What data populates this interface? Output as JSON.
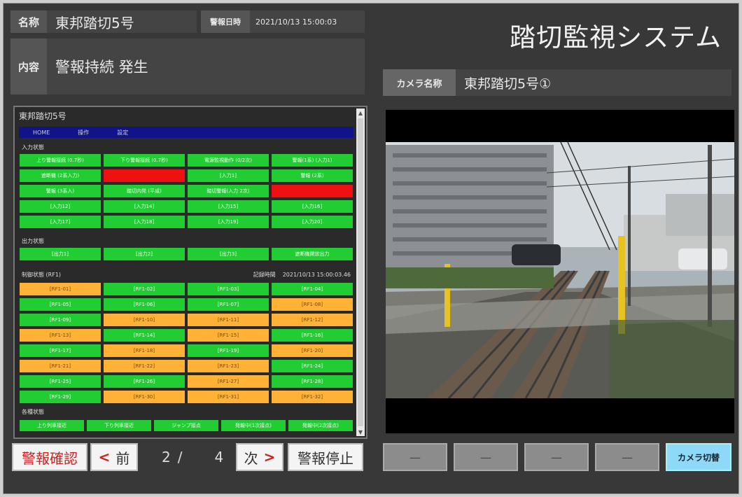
{
  "header": {
    "name_label": "名称",
    "name_value": "東邦踏切5号",
    "date_label": "警報日時",
    "date_value": "2021/10/13 15:00:03",
    "content_label": "内容",
    "content_value": "警報持続 発生"
  },
  "app_title": "踏切監視システム",
  "camera": {
    "name_label": "カメラ名称",
    "name_value": "東邦踏切5号①"
  },
  "panel": {
    "title": "東邦踏切5号",
    "nav": [
      "HOME",
      "操作",
      "設定"
    ],
    "section_input": "入力状態",
    "input_rows": [
      [
        [
          "上り警報接続 (0.7秒)",
          "g"
        ],
        [
          "下り警報接続 (0.7秒)",
          "g"
        ],
        [
          "電源監視動作 (0/2次)",
          "g"
        ],
        [
          "警報(1系) (入力1)",
          "g"
        ]
      ],
      [
        [
          "遮断機 (2系入力)",
          "g"
        ],
        [
          "",
          "r"
        ],
        [
          "[入力1]",
          "g"
        ],
        [
          "警報 (2系)",
          "g"
        ]
      ],
      [
        [
          "警報 (3系入)",
          "g"
        ],
        [
          "踏切内発 (平成)",
          "g"
        ],
        [
          "踏切警報(入力 2次)",
          "g"
        ],
        [
          "",
          "r"
        ]
      ],
      [
        [
          "[入力12]",
          "g"
        ],
        [
          "[入力14]",
          "g"
        ],
        [
          "[入力15]",
          "g"
        ],
        [
          "[入力16]",
          "g"
        ]
      ],
      [
        [
          "[入力17]",
          "g"
        ],
        [
          "[入力18]",
          "g"
        ],
        [
          "[入力19]",
          "g"
        ],
        [
          "[入力20]",
          "g"
        ]
      ]
    ],
    "section_output": "出力状態",
    "output_row": [
      [
        "[出力1]",
        "g"
      ],
      [
        "[出力2]",
        "g"
      ],
      [
        "[出力3]",
        "g"
      ],
      [
        "遮断機開放出力",
        "g"
      ]
    ],
    "section_relay": "制御状態 (RF1)",
    "relay_meta_label": "記録時間",
    "relay_meta_value": "2021/10/13 15:00:03.46",
    "relay_rows": [
      [
        [
          "[RF1-01]",
          "o"
        ],
        [
          "[RF1-02]",
          "g"
        ],
        [
          "[RF1-03]",
          "g"
        ],
        [
          "[RF1-04]",
          "g"
        ]
      ],
      [
        [
          "[RF1-05]",
          "g"
        ],
        [
          "[RF1-06]",
          "g"
        ],
        [
          "[RF1-07]",
          "g"
        ],
        [
          "[RF1-08]",
          "o"
        ]
      ],
      [
        [
          "[RF1-09]",
          "g"
        ],
        [
          "[RF1-10]",
          "o"
        ],
        [
          "[RF1-11]",
          "o"
        ],
        [
          "[RF1-12]",
          "o"
        ]
      ],
      [
        [
          "[RF1-13]",
          "o"
        ],
        [
          "[RF1-14]",
          "g"
        ],
        [
          "[RF1-15]",
          "o"
        ],
        [
          "[RF1-16]",
          "g"
        ]
      ],
      [
        [
          "[RF1-17]",
          "g"
        ],
        [
          "[RF1-18]",
          "o"
        ],
        [
          "[RF1-19]",
          "g"
        ],
        [
          "[RF1-20]",
          "o"
        ]
      ],
      [
        [
          "[RF1-21]",
          "o"
        ],
        [
          "[RF1-22]",
          "o"
        ],
        [
          "[RF1-23]",
          "o"
        ],
        [
          "[RF1-24]",
          "g"
        ]
      ],
      [
        [
          "[RF1-25]",
          "g"
        ],
        [
          "[RF1-26]",
          "g"
        ],
        [
          "[RF1-27]",
          "o"
        ],
        [
          "[RF1-28]",
          "g"
        ]
      ],
      [
        [
          "[RF1-29]",
          "g"
        ],
        [
          "[RF1-30]",
          "o"
        ],
        [
          "[RF1-31]",
          "o"
        ],
        [
          "[RF1-32]",
          "o"
        ]
      ]
    ],
    "section_misc": "各種状態",
    "misc_row": [
      [
        "上り列車接近",
        "g"
      ],
      [
        "下り列車接近",
        "g"
      ],
      [
        "ジャンプ接点",
        "g"
      ],
      [
        "発報中(1次接点)",
        "g"
      ],
      [
        "発報中(2次接点)",
        "g"
      ]
    ]
  },
  "footer": {
    "confirm_label": "警報確認",
    "prev_label": "前",
    "prev_arrow": "<",
    "page_current": "2",
    "page_sep": "/",
    "page_total": "4",
    "next_label": "次",
    "next_arrow": ">",
    "stop_label": "警報停止",
    "cam_buttons": [
      "—",
      "—",
      "—",
      "—"
    ],
    "cam_switch_label": "カメラ切替"
  },
  "colors": {
    "green": "#22cc33",
    "red": "#ee1111",
    "orange": "#ffb236",
    "nav_blue": "#111488",
    "cam_switch": "#8ed8f8"
  }
}
